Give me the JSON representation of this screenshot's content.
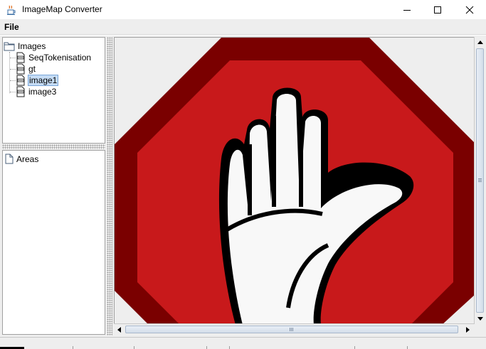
{
  "window": {
    "title": "ImageMap Converter",
    "app_icon": "java-cup-icon",
    "controls": [
      "minimize-icon",
      "maximize-icon",
      "close-icon"
    ]
  },
  "menu": {
    "items": [
      {
        "label": "File"
      }
    ]
  },
  "tree": {
    "root": {
      "label": "Images",
      "icon": "folder-open-icon"
    },
    "children": [
      {
        "label": "SeqTokenisation",
        "icon": "image-file-icon",
        "selected": false
      },
      {
        "label": "gt",
        "icon": "image-file-icon",
        "selected": false
      },
      {
        "label": "image1",
        "icon": "image-file-icon",
        "selected": true
      },
      {
        "label": "image3",
        "icon": "image-file-icon",
        "selected": false
      }
    ]
  },
  "areas": {
    "root": {
      "label": "Areas",
      "icon": "file-icon"
    }
  },
  "canvas": {
    "image": "stop-hand-sign",
    "colors": {
      "outer": "#7a0000",
      "inner": "#c8191b",
      "hand": "#f8f8f8",
      "outline": "#000000",
      "background": "#eeeeee"
    }
  },
  "scrollbars": {
    "vertical": {
      "icon_up": "arrow-up-icon",
      "icon_down": "arrow-down-icon"
    },
    "horizontal": {
      "icon_left": "arrow-left-icon",
      "icon_right": "arrow-right-icon"
    }
  }
}
